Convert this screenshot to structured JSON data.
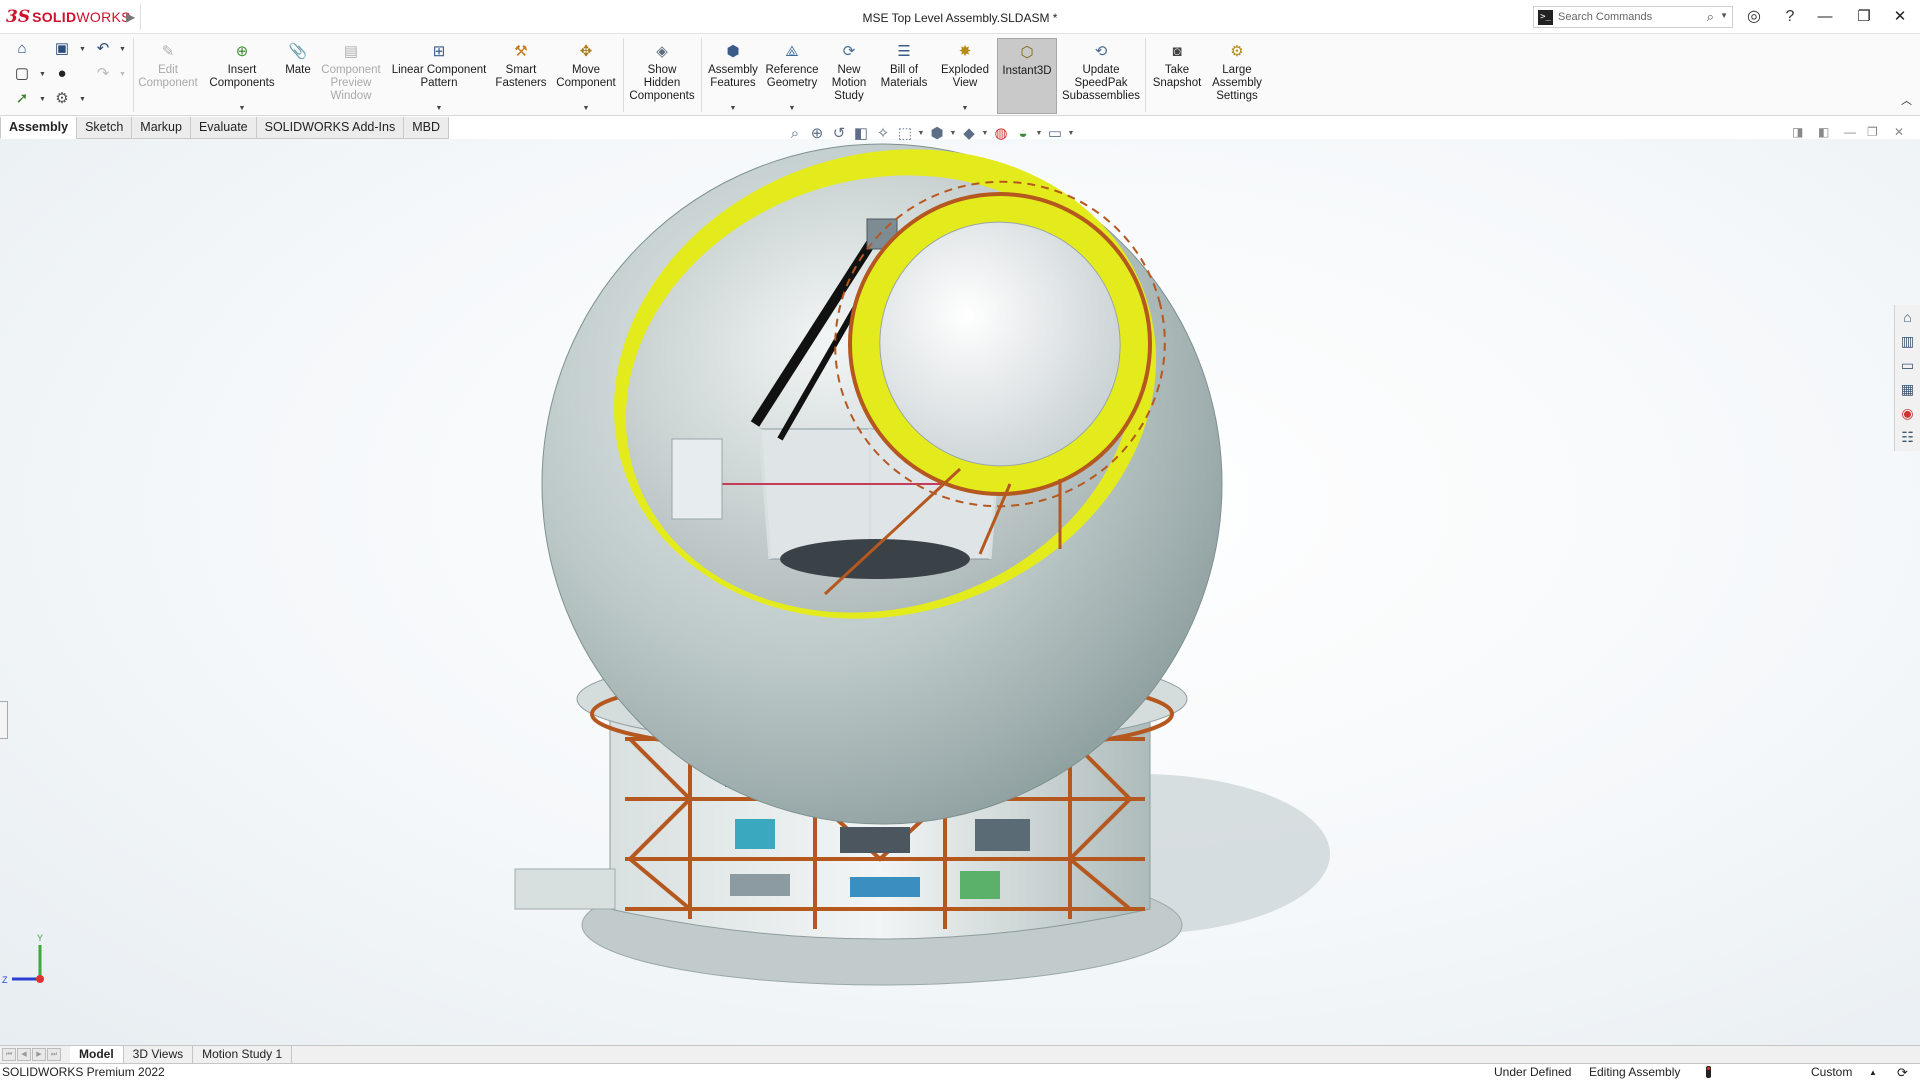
{
  "app": {
    "title": "MSE Top Level Assembly.SLDASM *",
    "logo_ds": "3S",
    "logo_brand_bold": "SOLID",
    "logo_brand_rest": "WORKS",
    "search": {
      "placeholder": "Search Commands"
    }
  },
  "ribbon": {
    "buttons": [
      {
        "label": "Edit\nComponent",
        "icon": "edit-component-icon"
      },
      {
        "label": "Insert\nComponents",
        "icon": "insert-components-icon"
      },
      {
        "label": "Mate",
        "icon": "mate-icon"
      },
      {
        "label": "Component\nPreview\nWindow",
        "icon": "component-preview-icon"
      },
      {
        "label": "Linear Component\nPattern",
        "icon": "linear-pattern-icon"
      },
      {
        "label": "Smart\nFasteners",
        "icon": "smart-fasteners-icon"
      },
      {
        "label": "Move\nComponent",
        "icon": "move-component-icon"
      },
      {
        "label": "Show\nHidden\nComponents",
        "icon": "show-hidden-icon"
      },
      {
        "label": "Assembly\nFeatures",
        "icon": "assembly-features-icon"
      },
      {
        "label": "Reference\nGeometry",
        "icon": "reference-geometry-icon"
      },
      {
        "label": "New\nMotion\nStudy",
        "icon": "motion-study-icon"
      },
      {
        "label": "Bill of\nMaterials",
        "icon": "bom-icon"
      },
      {
        "label": "Exploded\nView",
        "icon": "exploded-view-icon"
      },
      {
        "label": "Instant3D",
        "icon": "instant3d-icon"
      },
      {
        "label": "Update\nSpeedPak\nSubassemblies",
        "icon": "speedpak-icon"
      },
      {
        "label": "Take\nSnapshot",
        "icon": "snapshot-icon"
      },
      {
        "label": "Large\nAssembly\nSettings",
        "icon": "large-assembly-icon"
      }
    ]
  },
  "command_tabs": [
    "Assembly",
    "Sketch",
    "Markup",
    "Evaluate",
    "SOLIDWORKS Add-Ins",
    "MBD"
  ],
  "triad": {
    "y_label": "Y",
    "z_label": "Z"
  },
  "bottom_tabs": [
    "Model",
    "3D Views",
    "Motion Study 1"
  ],
  "status": {
    "product": "SOLIDWORKS Premium 2022",
    "definition": "Under Defined",
    "mode": "Editing Assembly",
    "units": "Custom"
  },
  "colors": {
    "accent_red": "#d0112b",
    "dome": "#c7d2d2",
    "dome_rim": "#e3eb1c",
    "truss": "#b5581f",
    "active_tool": "#c9c9c9"
  }
}
